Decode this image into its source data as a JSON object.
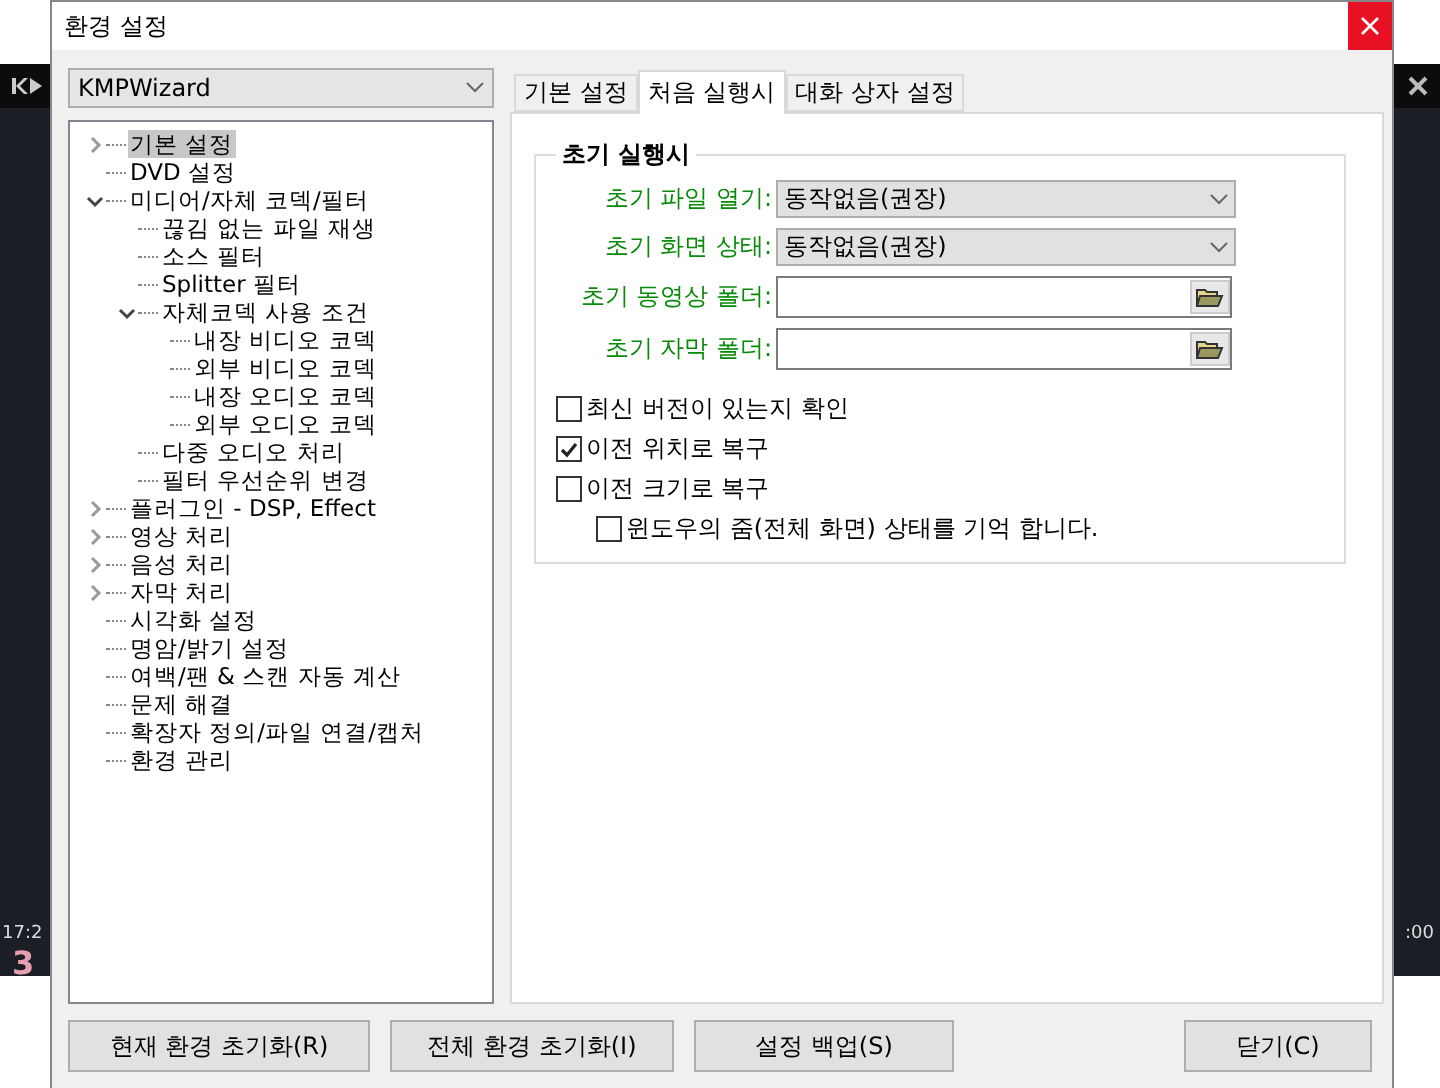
{
  "background_window": {
    "time_left": "17:2",
    "time_right": ":00",
    "counter": "3"
  },
  "window": {
    "title": "환경 설정"
  },
  "preset": {
    "value": "KMPWizard"
  },
  "tree": [
    {
      "label": "기본 설정",
      "selected": true,
      "expanded": false
    },
    {
      "label": "DVD 설정",
      "selected": false
    },
    {
      "label": "미디어/자체 코덱/필터",
      "selected": false,
      "expanded": true,
      "children": [
        {
          "label": "끊김 없는 파일 재생",
          "selected": false
        },
        {
          "label": "소스 필터",
          "selected": false
        },
        {
          "label": "Splitter 필터",
          "selected": false
        },
        {
          "label": "자체코덱 사용 조건",
          "selected": false,
          "expanded": true,
          "children": [
            {
              "label": "내장 비디오 코덱",
              "selected": false
            },
            {
              "label": "외부 비디오 코덱",
              "selected": false
            },
            {
              "label": "내장 오디오 코덱",
              "selected": false
            },
            {
              "label": "외부 오디오 코덱",
              "selected": false
            }
          ]
        },
        {
          "label": "다중 오디오 처리",
          "selected": false
        },
        {
          "label": "필터 우선순위 변경",
          "selected": false
        }
      ]
    },
    {
      "label": "플러그인 - DSP, Effect",
      "selected": false,
      "expanded": false
    },
    {
      "label": "영상 처리",
      "selected": false,
      "expanded": false
    },
    {
      "label": "음성 처리",
      "selected": false,
      "expanded": false
    },
    {
      "label": "자막 처리",
      "selected": false,
      "expanded": false
    },
    {
      "label": "시각화 설정",
      "selected": false
    },
    {
      "label": "명암/밝기 설정",
      "selected": false
    },
    {
      "label": "여백/팬 & 스캔 자동 계산",
      "selected": false
    },
    {
      "label": "문제 해결",
      "selected": false
    },
    {
      "label": "확장자 정의/파일 연결/캡처",
      "selected": false
    },
    {
      "label": "환경 관리",
      "selected": false
    }
  ],
  "tabs": [
    {
      "label": "기본 설정",
      "selected": false
    },
    {
      "label": "처음 실행시",
      "selected": true
    },
    {
      "label": "대화 상자 설정",
      "selected": false
    }
  ],
  "group": {
    "title": "초기 실행시",
    "fields": [
      {
        "kind": "select",
        "label": "초기 파일 열기:",
        "value": "동작없음(권장)"
      },
      {
        "kind": "select",
        "label": "초기 화면 상태:",
        "value": "동작없음(권장)"
      },
      {
        "kind": "folder",
        "label": "초기 동영상 폴더:"
      },
      {
        "kind": "folder",
        "label": "초기 자막 폴더:"
      }
    ],
    "checks": [
      {
        "label": "최신 버전이 있는지 확인",
        "checked": false
      },
      {
        "label": "이전 위치로 복구",
        "checked": true
      },
      {
        "label": "이전 크기로 복구",
        "checked": false,
        "children": [
          {
            "label": "윈도우의 줌(전체 화면) 상태를 기억 합니다.",
            "checked": false
          }
        ]
      }
    ]
  },
  "buttons": [
    "현재 환경 초기화(R)",
    "전체 환경 초기화(I)",
    "설정 백업(S)"
  ],
  "close_button": "닫기(C)"
}
